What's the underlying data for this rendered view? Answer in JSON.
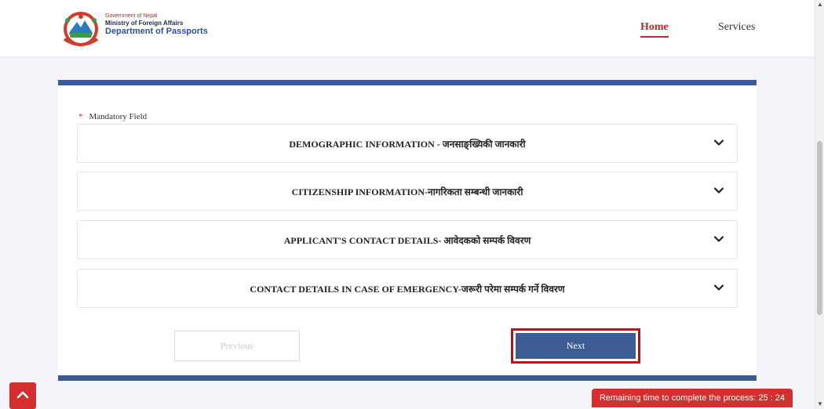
{
  "header": {
    "brand": {
      "line1": "Government of Nepal",
      "line2": "Ministry of Foreign Affairs",
      "line3": "Department of Passports"
    },
    "nav": {
      "home": "Home",
      "services": "Services"
    }
  },
  "form": {
    "mandatory_label": "Mandatory Field",
    "mandatory_star": "*",
    "sections": [
      {
        "title": "DEMOGRAPHIC INFORMATION - जनसाङ्ख्यिकी जानकारी"
      },
      {
        "title": "CITIZENSHIP INFORMATION-नागरिकता सम्बन्धी जानकारी"
      },
      {
        "title": "APPLICANT'S CONTACT DETAILS- आवेदकको सम्पर्क विवरण"
      },
      {
        "title": "CONTACT DETAILS IN CASE OF EMERGENCY-जरूरी परेमा सम्पर्क गर्ने विवरण"
      }
    ],
    "buttons": {
      "previous": "Previous",
      "next": "Next"
    }
  },
  "timer": {
    "text": "Remaining time to complete the process: 25 : 24"
  },
  "icons": {
    "accordion": "chevron-down-icon",
    "scroll_top": "chevron-up-icon",
    "logo": "nepal-emblem-icon"
  },
  "colors": {
    "accent_blue": "#3a5a92",
    "accent_red": "#d32f2f",
    "nav_active": "#c0272d"
  }
}
